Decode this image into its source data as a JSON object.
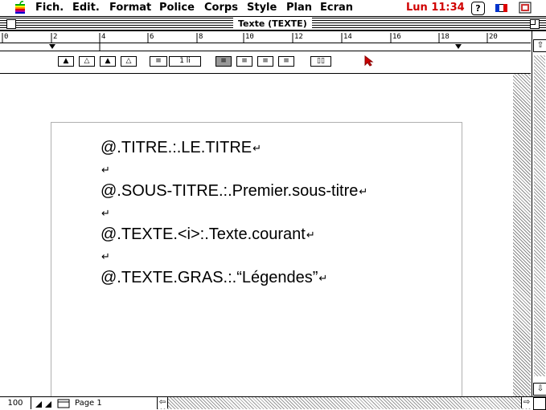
{
  "menubar": {
    "items": [
      "Fich.",
      "Edit.",
      "Format",
      "Police",
      "Corps",
      "Style",
      "Plan",
      "Ecran"
    ],
    "clock": "Lun 11:34",
    "help_glyph": "?",
    "flag_colors": [
      "#0033cc",
      "#ffffff",
      "#dd0000"
    ]
  },
  "window": {
    "title": "Texte (TEXTE)"
  },
  "ruler": {
    "labels": [
      "0",
      "2",
      "4",
      "6",
      "8",
      "10",
      "12",
      "14",
      "16",
      "18",
      "20"
    ]
  },
  "toolbar": {
    "spacing_value": "1 li"
  },
  "document": {
    "lines": [
      "@.TITRE.:.LE.TITRE",
      "",
      "@.SOUS-TITRE.:.Premier.sous-titre",
      "",
      "@.TEXTE.<i>:.Texte.courant",
      "",
      "@.TEXTE.GRAS.:.“Légendes”"
    ],
    "return_mark": "↵"
  },
  "status": {
    "zoom": "100",
    "page_label": "Page 1"
  },
  "colors": {
    "clock": "#d00000",
    "cursor": "#cc0000"
  }
}
